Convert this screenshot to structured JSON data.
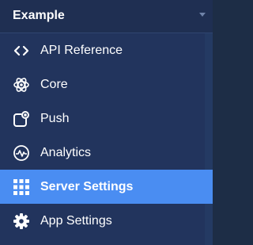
{
  "app_switcher": {
    "title": "Example",
    "caret_icon": "caret-down-icon"
  },
  "nav": {
    "items": [
      {
        "label": "API Reference",
        "icon": "code-brackets-icon",
        "active": false
      },
      {
        "label": "Core",
        "icon": "atom-icon",
        "active": false
      },
      {
        "label": "Push",
        "icon": "push-notification-icon",
        "active": false
      },
      {
        "label": "Analytics",
        "icon": "analytics-pulse-icon",
        "active": false
      },
      {
        "label": "Server Settings",
        "icon": "grid-icon",
        "active": true
      },
      {
        "label": "App Settings",
        "icon": "gear-icon",
        "active": false
      }
    ]
  },
  "colors": {
    "sidebar_bg": "#22345d",
    "header_bg": "#1f2f52",
    "active_bg": "#4a8df2",
    "text": "#ffffff"
  }
}
